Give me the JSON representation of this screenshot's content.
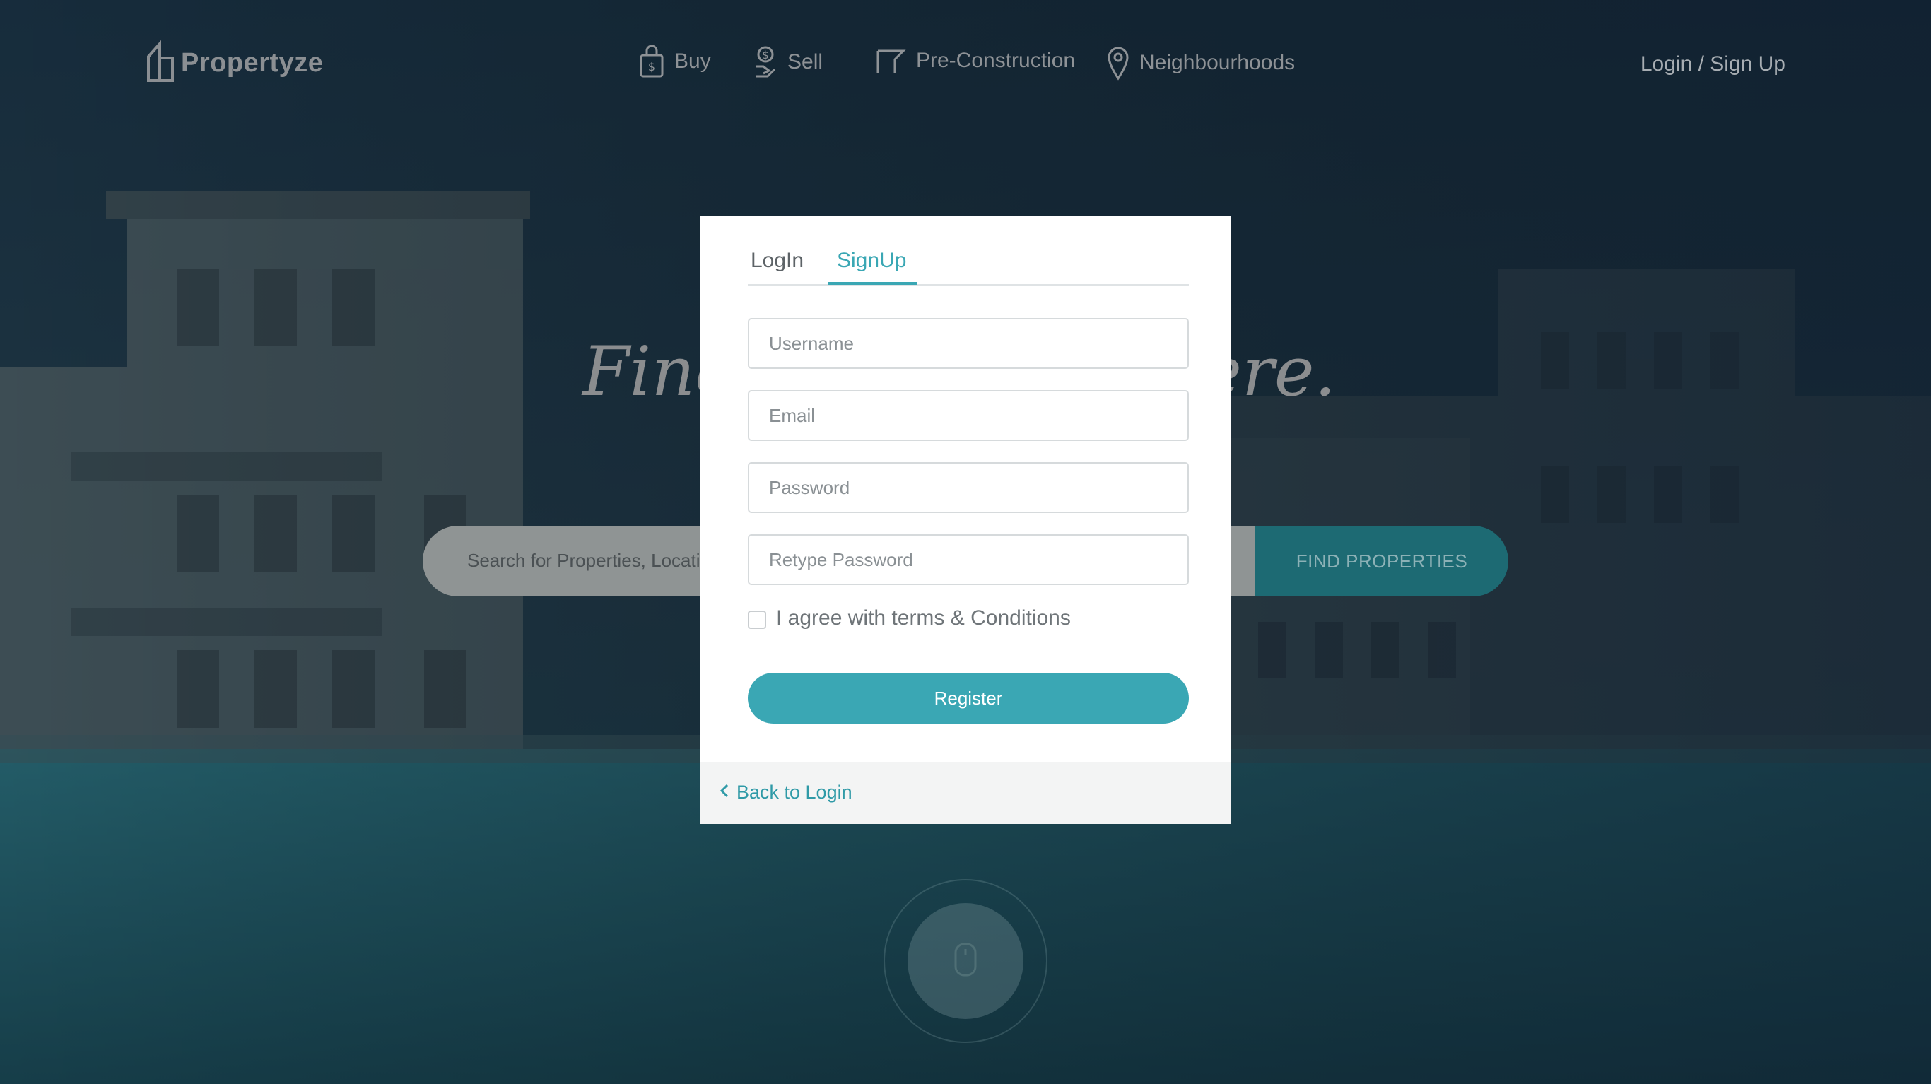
{
  "header": {
    "logo_text": "Propertyze",
    "nav": [
      {
        "label": "Buy",
        "icon": "shopping-bag-icon"
      },
      {
        "label": "Sell",
        "icon": "hand-money-icon"
      },
      {
        "label": "Pre-Construction",
        "icon": "construction-icon"
      },
      {
        "label": "Neighbourhoods",
        "icon": "map-pin-icon"
      }
    ],
    "login_label": "Login / Sign Up"
  },
  "hero": {
    "title": "Find ... here.",
    "title_left": "Finc",
    "title_right": "ere.",
    "search_placeholder": "Search for Properties, Locati",
    "find_button": "FIND PROPERTIES"
  },
  "modal": {
    "tabs": [
      {
        "label": "LogIn",
        "active": false
      },
      {
        "label": "SignUp",
        "active": true
      }
    ],
    "fields": {
      "username_placeholder": "Username",
      "email_placeholder": "Email",
      "password_placeholder": "Password",
      "retype_placeholder": "Retype Password"
    },
    "agree_label": "I agree with terms & Conditions",
    "agree_checked": false,
    "register_label": "Register",
    "back_label": "Back to Login"
  },
  "colors": {
    "accent": "#3aa7b4",
    "find_button": "#1d6a73",
    "overlay_top": "#1e3a4a",
    "water": "#2f8a96"
  }
}
